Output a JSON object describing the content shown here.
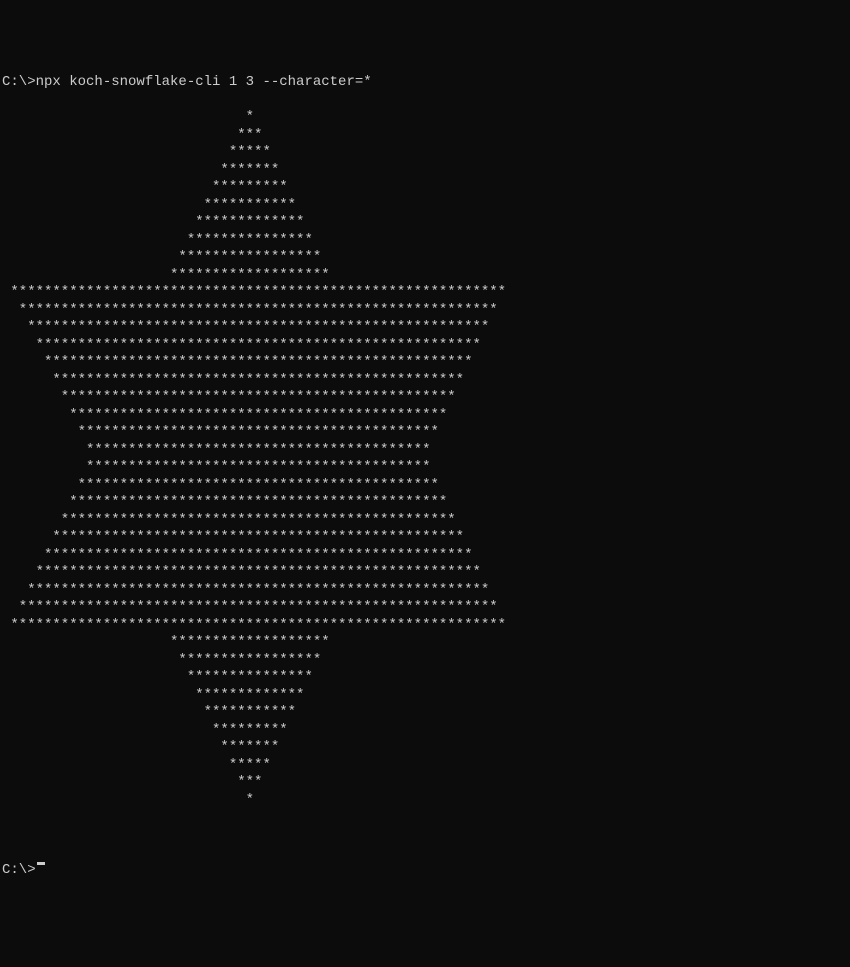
{
  "prompt": "C:\\>",
  "command": "npx koch-snowflake-cli 1 3 --character=*",
  "output_lines": [
    "                             *",
    "                            ***",
    "                           *****",
    "                          *******",
    "                         *********",
    "                        ***********",
    "                       *************",
    "                      ***************",
    "                     *****************",
    "                    *******************",
    " ***********************************************************",
    "  *********************************************************",
    "   *******************************************************",
    "    *****************************************************",
    "     ***************************************************",
    "      *************************************************",
    "       ***********************************************",
    "        *********************************************",
    "         *******************************************",
    "          *****************************************",
    "          *****************************************",
    "         *******************************************",
    "        *********************************************",
    "       ***********************************************",
    "      *************************************************",
    "     ***************************************************",
    "    *****************************************************",
    "   *******************************************************",
    "  *********************************************************",
    " ***********************************************************",
    "                    *******************",
    "                     *****************",
    "                      ***************",
    "                       *************",
    "                        ***********",
    "                         *********",
    "                          *******",
    "                           *****",
    "                            ***",
    "                             *"
  ],
  "prompt2": "C:\\>"
}
